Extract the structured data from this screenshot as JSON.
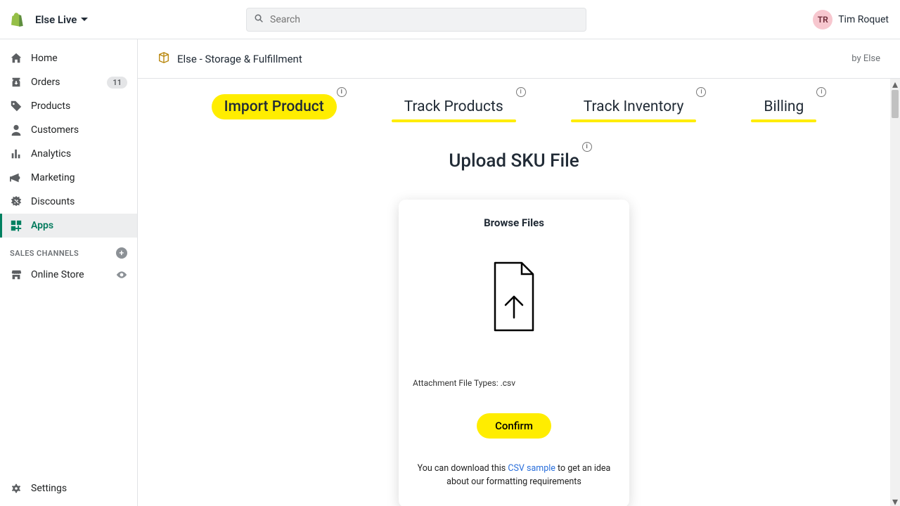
{
  "topbar": {
    "store_name": "Else Live",
    "search_placeholder": "Search",
    "avatar_initials": "TR",
    "user_name": "Tim Roquet"
  },
  "sidebar": {
    "items": [
      {
        "label": "Home"
      },
      {
        "label": "Orders",
        "badge": "11"
      },
      {
        "label": "Products"
      },
      {
        "label": "Customers"
      },
      {
        "label": "Analytics"
      },
      {
        "label": "Marketing"
      },
      {
        "label": "Discounts"
      },
      {
        "label": "Apps"
      }
    ],
    "channels_header": "SALES CHANNELS",
    "channels": [
      {
        "label": "Online Store"
      }
    ],
    "settings_label": "Settings"
  },
  "app_header": {
    "title": "Else - Storage & Fulfillment",
    "by": "by Else"
  },
  "tabs": [
    {
      "label": "Import Product",
      "active": true
    },
    {
      "label": "Track Products"
    },
    {
      "label": "Track Inventory"
    },
    {
      "label": "Billing"
    }
  ],
  "upload": {
    "heading": "Upload SKU File",
    "card_title": "Browse Files",
    "filetypes": "Attachment File Types: .csv",
    "confirm_label": "Confirm",
    "hint_before": "You can download this ",
    "hint_link": "CSV sample",
    "hint_after": " to get an idea about our formatting requirements"
  }
}
